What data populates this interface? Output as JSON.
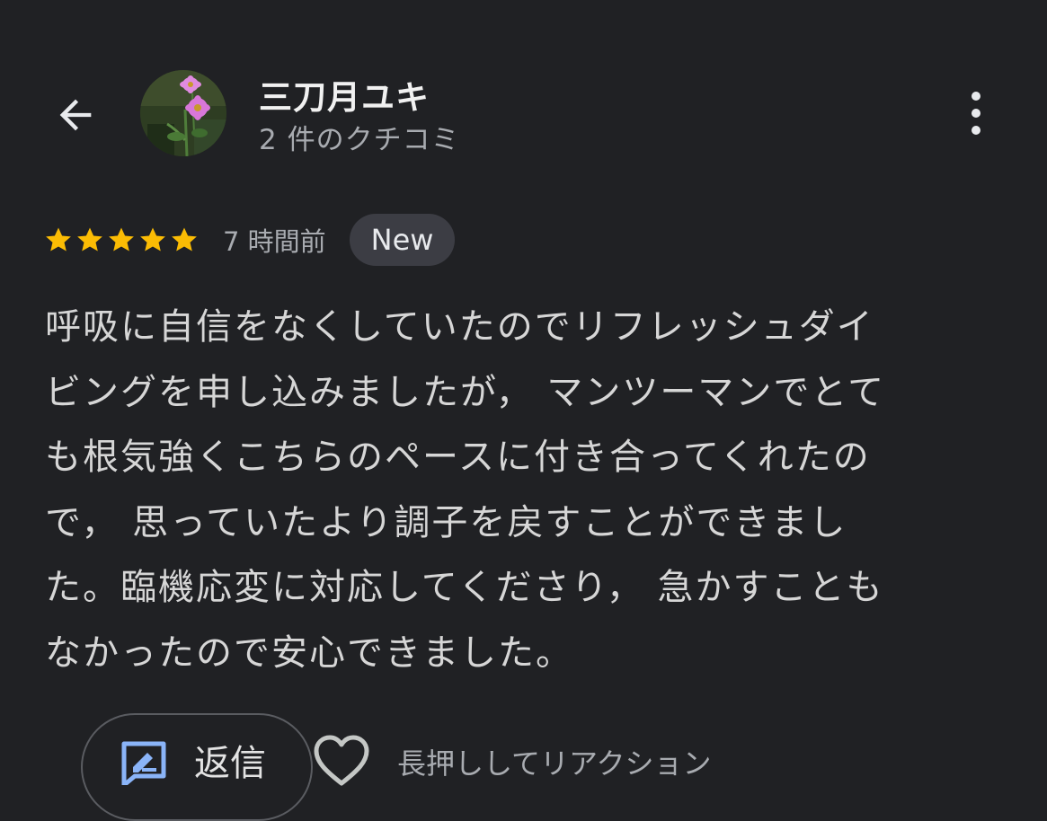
{
  "header": {
    "back_icon": "arrow-left-icon",
    "reviewer_name": "三刀月ユキ",
    "review_count": "2 件のクチコミ",
    "more_icon": "more-vert-icon"
  },
  "review": {
    "rating": 5,
    "rating_max": 5,
    "star_color": "#fbbc04",
    "time_ago": "7 時間前",
    "badge": "New",
    "text_lines": [
      "呼吸に自信をなくしていたのでリフレッシュダイ",
      "ビングを申し込みましたが， マンツーマンでとて",
      "も根気強くこちらのペースに付き合ってくれたの",
      "で， 思っていたより調子を戻すことができまし",
      "た。臨機応変に対応してくださり， 急かすことも",
      "なかったので安心できました。"
    ]
  },
  "actions": {
    "reply_icon": "reply-icon",
    "reply_label": "返信",
    "reply_icon_color": "#8ab4f8",
    "reaction_icon": "heart-outline-icon",
    "reaction_label": "長押ししてリアクション"
  },
  "colors": {
    "background": "#202124",
    "badge_background": "#3c3d44",
    "secondary_text": "#a8abb0"
  }
}
